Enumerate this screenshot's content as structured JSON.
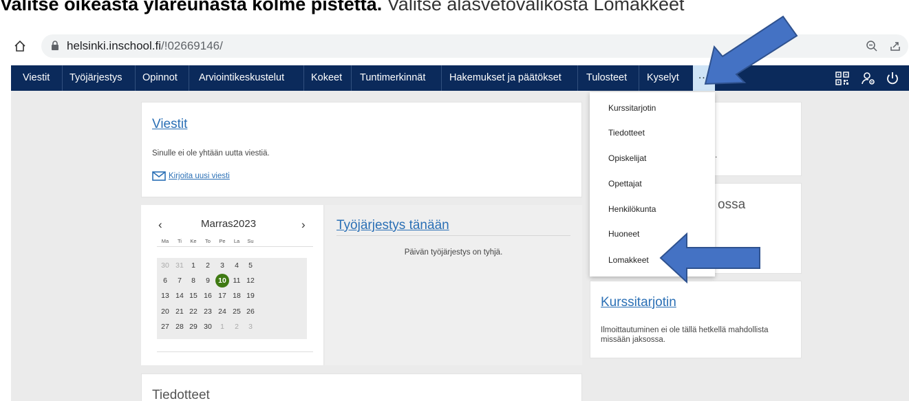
{
  "caption": {
    "text": "Valitse oikeasta yläreunasta kolme pistettä.",
    "light": "Valitse alasvetovalikosta Lomakkeet"
  },
  "browser": {
    "url_host": "helsinki.inschool.fi",
    "url_path": "/!02669146/"
  },
  "nav": {
    "items": [
      "Viestit",
      "Työjärjestys",
      "Opinnot",
      "Arviointikeskustelut",
      "Kokeet",
      "Tuntimerkinnät",
      "Hakemukset ja päätökset",
      "Tulosteet",
      "Kyselyt"
    ],
    "more_label": "..."
  },
  "messages": {
    "title": "Viestit",
    "empty_text": "Sinulle ei ole yhtään uutta viestiä.",
    "compose_link": "Kirjoita uusi viesti"
  },
  "calendar": {
    "month_label": "Marras2023",
    "weekdays": [
      "Ma",
      "Ti",
      "Ke",
      "To",
      "Pe",
      "La",
      "Su"
    ],
    "weeks": [
      [
        {
          "d": "30",
          "o": true
        },
        {
          "d": "31",
          "o": true
        },
        {
          "d": "1"
        },
        {
          "d": "2"
        },
        {
          "d": "3"
        },
        {
          "d": "4"
        },
        {
          "d": "5"
        }
      ],
      [
        {
          "d": "6"
        },
        {
          "d": "7"
        },
        {
          "d": "8"
        },
        {
          "d": "9"
        },
        {
          "d": "10",
          "t": true
        },
        {
          "d": "11"
        },
        {
          "d": "12"
        }
      ],
      [
        {
          "d": "13"
        },
        {
          "d": "14"
        },
        {
          "d": "15"
        },
        {
          "d": "16"
        },
        {
          "d": "17"
        },
        {
          "d": "18"
        },
        {
          "d": "19"
        }
      ],
      [
        {
          "d": "20"
        },
        {
          "d": "21"
        },
        {
          "d": "22"
        },
        {
          "d": "23"
        },
        {
          "d": "24"
        },
        {
          "d": "25"
        },
        {
          "d": "26"
        }
      ],
      [
        {
          "d": "27"
        },
        {
          "d": "28"
        },
        {
          "d": "29"
        },
        {
          "d": "30"
        },
        {
          "d": "1",
          "o": true
        },
        {
          "d": "2",
          "o": true
        },
        {
          "d": "3",
          "o": true
        }
      ]
    ]
  },
  "schedule": {
    "title": "Työjärjestys tänään",
    "empty_text": "Päivän työjärjestys on tyhjä."
  },
  "bulletins": {
    "title": "Tiedotteet"
  },
  "dropdown": {
    "items": [
      "Kurssitarjotin",
      "Tiedotteet",
      "Opiskelijat",
      "Opettajat",
      "Henkilökunta",
      "Huoneet",
      "Lomakkeet"
    ]
  },
  "right_panel": {
    "partial_text": "ossa",
    "course_title": "Kurssitarjotin",
    "course_text_1": "Ilmoittautuminen ei ole tällä hetkellä mahdollista",
    "course_text_2": "missään jaksossa."
  },
  "colors": {
    "nav_bg": "#0b2a5b",
    "link": "#2a6fb5",
    "today": "#3f7a13",
    "arrow": "#4472c4"
  }
}
